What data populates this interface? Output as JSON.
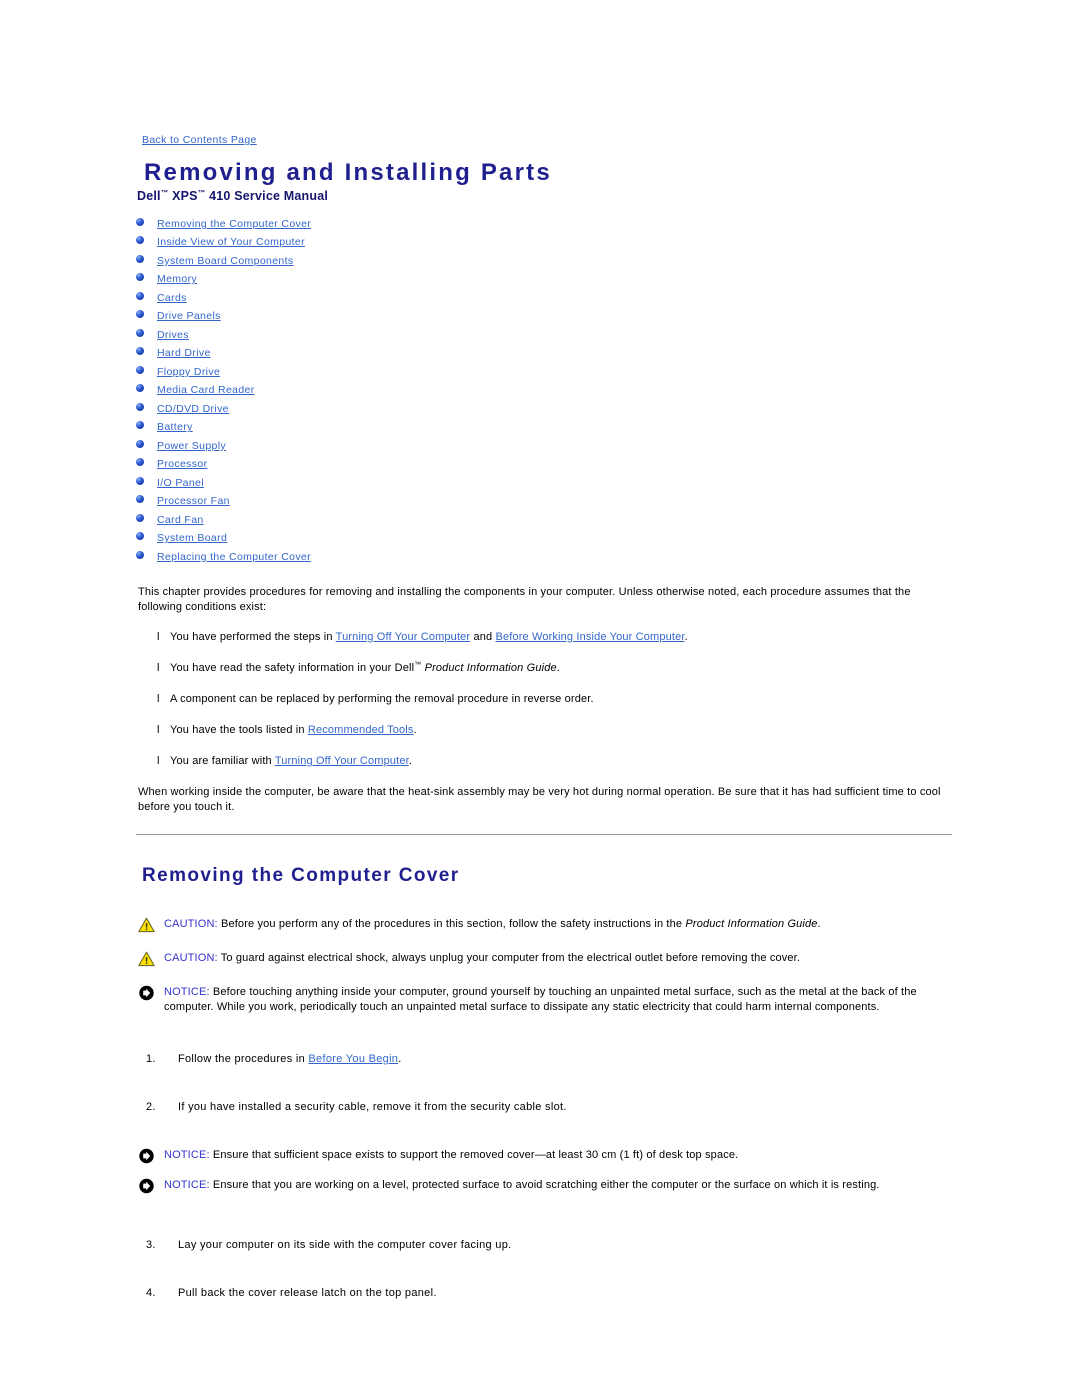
{
  "nav": {
    "back_link": "Back to Contents Page"
  },
  "header": {
    "title": "Removing and Installing Parts",
    "subtitle_part1": "Dell",
    "subtitle_tm1": "™",
    "subtitle_part2": " XPS",
    "subtitle_tm2": "™",
    "subtitle_part3": " 410 Service Manual"
  },
  "toc": {
    "items": [
      {
        "label": "Removing the Computer Cover"
      },
      {
        "label": "Inside View of Your Computer"
      },
      {
        "label": "System Board Components"
      },
      {
        "label": "Memory"
      },
      {
        "label": "Cards"
      },
      {
        "label": "Drive Panels"
      },
      {
        "label": "Drives"
      },
      {
        "label": "Hard Drive"
      },
      {
        "label": "Floppy Drive"
      },
      {
        "label": "Media Card Reader"
      },
      {
        "label": "CD/DVD Drive"
      },
      {
        "label": "Battery"
      },
      {
        "label": "Power Supply"
      },
      {
        "label": "Processor"
      },
      {
        "label": "I/O Panel"
      },
      {
        "label": "Processor Fan"
      },
      {
        "label": "Card Fan"
      },
      {
        "label": "System Board"
      },
      {
        "label": "Replacing the Computer Cover"
      }
    ]
  },
  "intro": {
    "paragraph": "This chapter provides procedures for removing and installing the components in your computer. Unless otherwise noted, each procedure assumes that the following conditions exist:",
    "conditions": {
      "marker": "l",
      "item1_pre": "You have performed the steps in ",
      "item1_link1": "Turning Off Your Computer",
      "item1_mid": " and ",
      "item1_link2": "Before Working Inside Your Computer",
      "item1_post": ".",
      "item2_pre": "You have read the safety information in your Dell",
      "item2_tm": "™",
      "item2_mid": " ",
      "item2_italic": "Product Information Guide",
      "item2_post": ".",
      "item3": "A component can be replaced by performing the removal procedure in reverse order.",
      "item4_pre": "You have the tools listed in ",
      "item4_link": "Recommended Tools",
      "item4_post": ".",
      "item5_pre": "You are familiar with ",
      "item5_link": "Turning Off Your Computer",
      "item5_post": "."
    },
    "warning_paragraph": "When working inside the computer, be aware that the heat-sink assembly may be very hot during normal operation. Be sure that it has had sufficient time to cool before you touch it."
  },
  "section": {
    "title": "Removing the Computer Cover",
    "caution1": {
      "label": "CAUTION:",
      "text_pre": " Before you perform any of the procedures in this section, follow the safety instructions in the ",
      "text_italic": "Product Information Guide",
      "text_post": "."
    },
    "caution2": {
      "label": "CAUTION:",
      "text": " To guard against electrical shock, always unplug your computer from the electrical outlet before removing the cover."
    },
    "notice1": {
      "label": "NOTICE:",
      "text": " Before touching anything inside your computer, ground yourself by touching an unpainted metal surface, such as the metal at the back of the computer. While you work, periodically touch an unpainted metal surface to dissipate any static electricity that could harm internal components."
    },
    "notice2": {
      "label": "NOTICE:",
      "text": " Ensure that sufficient space exists to support the removed cover—at least 30 cm (1 ft) of desk top space."
    },
    "notice3": {
      "label": "NOTICE:",
      "text": " Ensure that you are working on a level, protected surface to avoid scratching either the computer or the surface on which it is resting."
    },
    "steps": {
      "step1_num": "1.",
      "step1_pre": "Follow the procedures in ",
      "step1_link": "Before You Begin",
      "step1_post": ".",
      "step2_num": "2.",
      "step2_text": "If you have installed a security cable, remove it from the security cable slot.",
      "step3_num": "3.",
      "step3_text": "Lay your computer on its side with the computer cover facing up.",
      "step4_num": "4.",
      "step4_text": "Pull back the cover release latch on the top panel."
    }
  },
  "colors": {
    "link": "#3366cc",
    "title": "#1f1f8f",
    "note_label": "#3333cc",
    "caution_icon": "#ffe000",
    "bullet": "#2b5bd7",
    "rule": "#9a9a9a"
  }
}
